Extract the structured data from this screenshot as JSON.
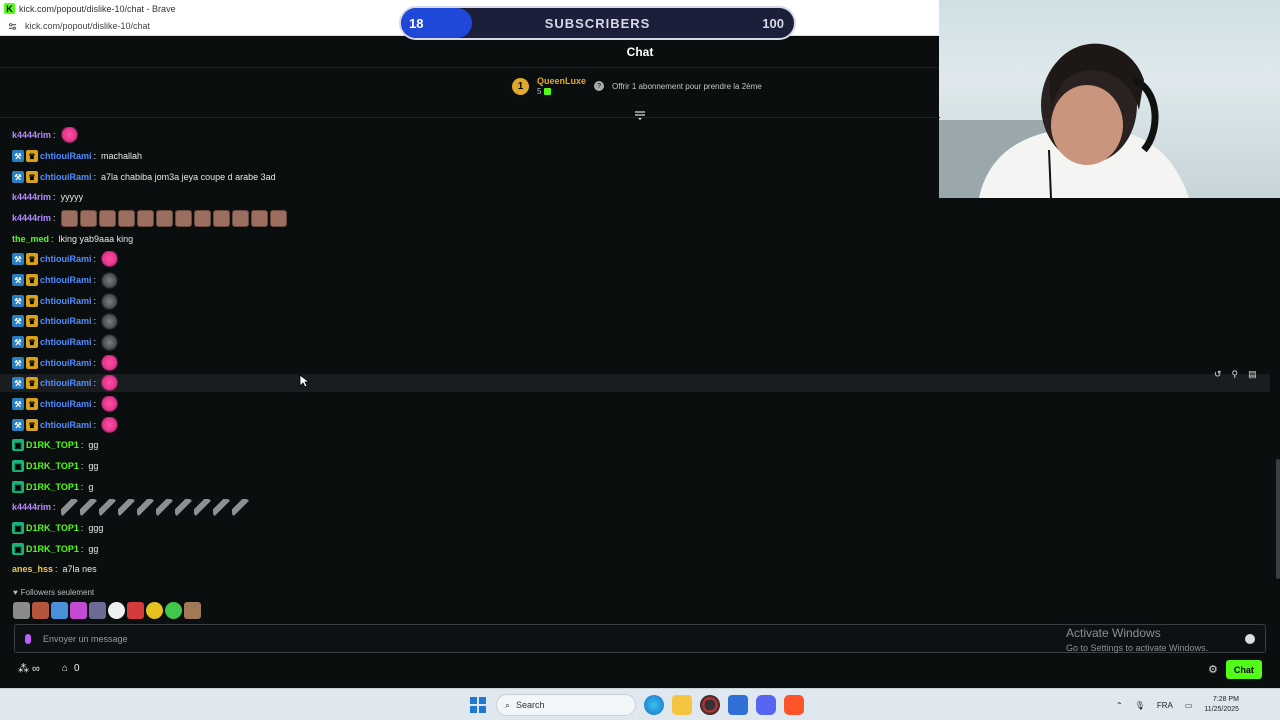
{
  "browser": {
    "title": "kick.com/popout/dislike-10/chat - Brave",
    "url": "kick.com/popout/dislike-10/chat"
  },
  "subscribers": {
    "current": "18",
    "label": "SUBSCRIBERS",
    "goal": "100",
    "progress": 0.18
  },
  "chat": {
    "title": "Chat",
    "pinned": {
      "rank": "1",
      "user": "QueenLuxe",
      "count": "5",
      "promo": "Offrir 1 abonnement pour prendre la 2ème"
    },
    "messages": [
      {
        "user": "k4444rim",
        "color": "#b38bff",
        "badges": [],
        "text": "",
        "emotes": [
          "heart"
        ]
      },
      {
        "user": "chtiouiRami",
        "color": "#4f8cff",
        "badges": [
          "mod",
          "vip"
        ],
        "text": "machallah",
        "emotes": []
      },
      {
        "user": "chtiouiRami",
        "color": "#4f8cff",
        "badges": [
          "mod",
          "vip"
        ],
        "text": "a7la chabiba jom3a jeya coupe d arabe 3ad",
        "emotes": []
      },
      {
        "user": "k4444rim",
        "color": "#b38bff",
        "badges": [],
        "text": "yyyyy",
        "emotes": []
      },
      {
        "user": "k4444rim",
        "color": "#b38bff",
        "badges": [],
        "text": "",
        "emotes": [
          "face",
          "face",
          "face",
          "face",
          "face",
          "face",
          "face",
          "face",
          "face",
          "face",
          "face",
          "face"
        ]
      },
      {
        "user": "the_med",
        "color": "#53fc18",
        "badges": [],
        "text": "lking yab9aaa king",
        "emotes": []
      },
      {
        "user": "chtiouiRami",
        "color": "#4f8cff",
        "badges": [
          "mod",
          "vip"
        ],
        "text": "",
        "emotes": [
          "heart"
        ]
      },
      {
        "user": "chtiouiRami",
        "color": "#4f8cff",
        "badges": [
          "mod",
          "vip"
        ],
        "text": "",
        "emotes": [
          "fig"
        ]
      },
      {
        "user": "chtiouiRami",
        "color": "#4f8cff",
        "badges": [
          "mod",
          "vip"
        ],
        "text": "",
        "emotes": [
          "fig"
        ]
      },
      {
        "user": "chtiouiRami",
        "color": "#4f8cff",
        "badges": [
          "mod",
          "vip"
        ],
        "text": "",
        "emotes": [
          "fig"
        ]
      },
      {
        "user": "chtiouiRami",
        "color": "#4f8cff",
        "badges": [
          "mod",
          "vip"
        ],
        "text": "",
        "emotes": [
          "fig"
        ]
      },
      {
        "user": "chtiouiRami",
        "color": "#4f8cff",
        "badges": [
          "mod",
          "vip"
        ],
        "text": "",
        "emotes": [
          "heart"
        ]
      },
      {
        "user": "chtiouiRami",
        "color": "#4f8cff",
        "badges": [
          "mod",
          "vip"
        ],
        "text": "",
        "emotes": [
          "heart"
        ],
        "highlighted": true
      },
      {
        "user": "chtiouiRami",
        "color": "#4f8cff",
        "badges": [
          "mod",
          "vip"
        ],
        "text": "",
        "emotes": [
          "heart"
        ]
      },
      {
        "user": "chtiouiRami",
        "color": "#4f8cff",
        "badges": [
          "mod",
          "vip"
        ],
        "text": "",
        "emotes": [
          "heart"
        ]
      },
      {
        "user": "D1RK_TOP1",
        "color": "#53fc18",
        "badges": [
          "bot"
        ],
        "text": "gg",
        "emotes": []
      },
      {
        "user": "D1RK_TOP1",
        "color": "#53fc18",
        "badges": [
          "bot"
        ],
        "text": "gg",
        "emotes": []
      },
      {
        "user": "D1RK_TOP1",
        "color": "#53fc18",
        "badges": [
          "bot"
        ],
        "text": "g",
        "emotes": []
      },
      {
        "user": "k4444rim",
        "color": "#b38bff",
        "badges": [],
        "text": "",
        "emotes": [
          "gun",
          "gun",
          "gun",
          "gun",
          "gun",
          "gun",
          "gun",
          "gun",
          "gun",
          "gun"
        ]
      },
      {
        "user": "D1RK_TOP1",
        "color": "#53fc18",
        "badges": [
          "bot"
        ],
        "text": "ggg",
        "emotes": []
      },
      {
        "user": "D1RK_TOP1",
        "color": "#53fc18",
        "badges": [
          "bot"
        ],
        "text": "gg",
        "emotes": []
      },
      {
        "user": "anes_hss",
        "color": "#f2c94c",
        "badges": [],
        "text": "a7la nes",
        "emotes": []
      }
    ],
    "followers_only": "Followers seulement",
    "input_placeholder": "Envoyer un message",
    "send_label": "Chat",
    "bottom_count": "0"
  },
  "watermark": {
    "title": "Activate Windows",
    "subtitle": "Go to Settings to activate Windows."
  },
  "taskbar": {
    "search": "Search",
    "lang": "FRA",
    "time": "7:28 PM",
    "date": "11/25/2025"
  }
}
